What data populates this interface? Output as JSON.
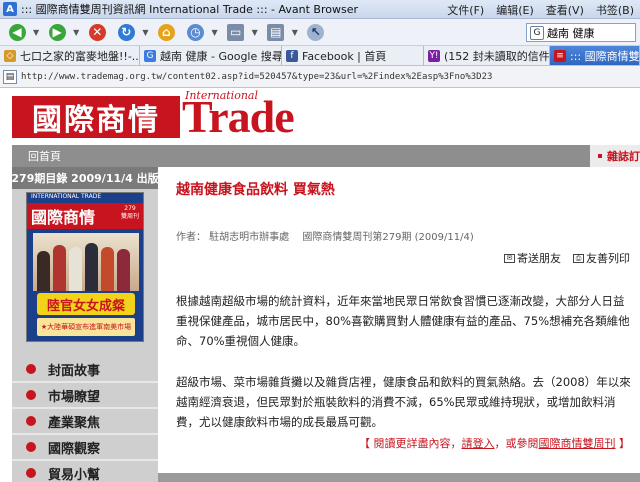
{
  "browser": {
    "app_icon": "A",
    "title": "::: 國際商情雙周刊資訊網 International Trade ::: - Avant Browser",
    "menu": [
      "文件(F)",
      "编辑(E)",
      "查看(V)",
      "书签(B)"
    ],
    "search_value": "越南 健康",
    "search_engine_icon": "G",
    "tabs": [
      {
        "label": "七口之家的富麥地盤!!-...",
        "icon_text": "◇",
        "color": "#d79a2a"
      },
      {
        "label": "越南 健康 - Google 搜尋",
        "icon_text": "G",
        "color": "#3d7be0"
      },
      {
        "label": "Facebook | 首頁",
        "icon_text": "f",
        "color": "#3b5998"
      },
      {
        "label": "(152 封未讀取的信件 -...",
        "icon_text": "Y!",
        "color": "#7b1fa2"
      },
      {
        "label": "::: 國際商情雙...",
        "icon_text": "≡",
        "color": "#c8141f"
      }
    ],
    "url": "http://www.trademag.org.tw/content02.asp?id=520457&type=23&url=%2Findex%2Easp%3Fno%3D23"
  },
  "site": {
    "logo_cn": "國際商情",
    "logo_international": "International",
    "logo_trade": "Trade",
    "home_link": "回首頁",
    "subscribe": "雜誌訂"
  },
  "sidebar": {
    "issue_header": "279期目錄  2009/11/4 出版",
    "cover": {
      "top_text": "INTERNATIONAL TRADE",
      "logo": "國際商情",
      "issue": "279",
      "issue_sub": "雙周刊",
      "headline": "陸官女女成粲",
      "subline": "★大陸華碩宣布進軍南美市場"
    },
    "items": [
      "封面故事",
      "市場瞭望",
      "產業聚焦",
      "國際觀察",
      "貿易小幫"
    ]
  },
  "article": {
    "title": "越南健康食品飲料 買氣熱",
    "author": "作者： 駐胡志明市辦事處",
    "source": "國際商情雙周刊第279期 (2009/11/4)",
    "tools": [
      "寄送朋友",
      "友善列印"
    ],
    "paragraph1": "根據越南超級市場的統計資料，近年來當地民眾日常飲食習慣已逐漸改變，大部分人日益重視保健產品，城市居民中，80%喜歡購買對人體健康有益的產品、75%想補充各類維他命、70%重視個人健康。",
    "paragraph2": "超級市場、菜市場雜貨攤以及雜貨店裡，健康食品和飲料的買氣熱絡。去（2008）年以來越南經濟衰退，但民眾對於瓶裝飲料的消費不減，65%民眾或維持現狀，或增加飲料消費，尤以健康飲料市場的成長最爲可觀。",
    "readmore_prefix": "【 閱讀更詳盡內容，",
    "readmore_login": "請登入",
    "readmore_mid": "，或參閱",
    "readmore_mag": "國際商情雙周刊",
    "readmore_suffix": " 】"
  },
  "colors": {
    "brand_red": "#c8141f",
    "nav_gray": "#8e8e8e",
    "sidebar_gray": "#cfcfcf"
  }
}
